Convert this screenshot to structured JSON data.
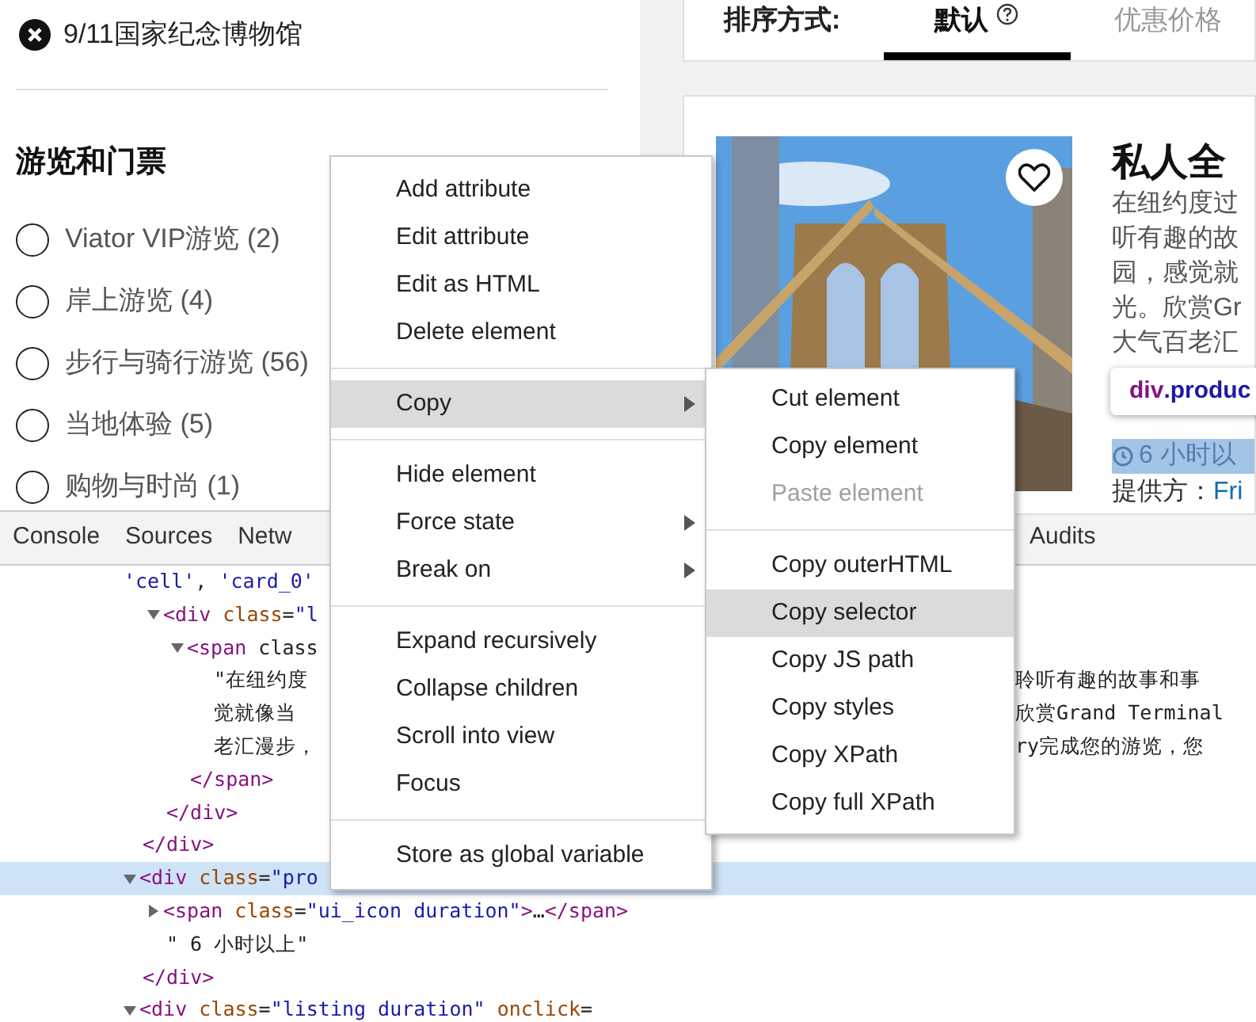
{
  "page": {
    "removed_filter": "9/11国家纪念博物馆",
    "section_title": "游览和门票",
    "filters": [
      {
        "label": "Viator VIP游览 (2)",
        "selected": false
      },
      {
        "label": "岸上游览 (4)",
        "selected": false
      },
      {
        "label": "步行与骑行游览 (56)",
        "selected": false
      },
      {
        "label": "当地体验 (5)",
        "selected": false
      },
      {
        "label": "购物与时尚 (1)",
        "selected": false
      }
    ],
    "sort": {
      "label": "排序方式:",
      "options": [
        {
          "label": "默认",
          "selected": true
        },
        {
          "label": "优惠价格",
          "selected": false
        }
      ]
    },
    "product": {
      "favorited": false,
      "title": "私人全",
      "description_lines": [
        "在纽约度过",
        "听有趣的故",
        "园，感觉就",
        "光。欣赏Gr",
        "大气百老汇"
      ],
      "duration": "6 小时以",
      "supplier_label": "提供方：",
      "supplier_link": "Fri"
    }
  },
  "devtools": {
    "tabs": [
      {
        "label": "Console",
        "selected": false
      },
      {
        "label": "Sources",
        "selected": false
      },
      {
        "label": "Netw",
        "selected": false
      },
      {
        "label": "Audits",
        "selected": false
      }
    ],
    "nodes": [
      {
        "kind": "continuation",
        "text": "'cell', 'card_0'",
        "children": [
          {
            "kind": "element",
            "open": "<div class=\"l",
            "expanded": true,
            "selected": false,
            "children": [
              {
                "kind": "element",
                "open": "<span class",
                "expanded": true,
                "selected": false,
                "children": [
                  {
                    "kind": "text",
                    "text": "\"在纽约度",
                    "overflow": "聆听有趣的故事和事"
                  },
                  {
                    "kind": "text",
                    "text": "觉就像当",
                    "overflow": "欣赏Grand Terminal"
                  },
                  {
                    "kind": "text",
                    "text": "老汇漫步，",
                    "overflow": "ry完成您的游览，您"
                  }
                ],
                "close": "</span>"
              }
            ],
            "close": "</div>"
          }
        ],
        "close": "</div>"
      },
      {
        "kind": "element",
        "open": "<div class=\"pro",
        "expanded": true,
        "selected": true,
        "children": [
          {
            "kind": "element",
            "open": "<span class=\"ui_icon duration\">…</span>",
            "expanded": false,
            "selected": false
          },
          {
            "kind": "text",
            "text": "\" 6 小时以上\""
          }
        ],
        "close": "</div>"
      },
      {
        "kind": "element",
        "open": "<div class=\"listing duration\" onclick=",
        "expanded": true,
        "selected": false
      }
    ]
  },
  "tooltip": {
    "tag": "div",
    "selector": ".produc"
  },
  "context_menu": {
    "groups": [
      [
        {
          "label": "Add attribute",
          "submenu": false,
          "selected": false,
          "disabled": false
        },
        {
          "label": "Edit attribute",
          "submenu": false,
          "selected": false,
          "disabled": false
        },
        {
          "label": "Edit as HTML",
          "submenu": false,
          "selected": false,
          "disabled": false
        },
        {
          "label": "Delete element",
          "submenu": false,
          "selected": false,
          "disabled": false
        }
      ],
      [
        {
          "label": "Copy",
          "submenu": true,
          "selected": true,
          "disabled": false
        }
      ],
      [
        {
          "label": "Hide element",
          "submenu": false,
          "selected": false,
          "disabled": false
        },
        {
          "label": "Force state",
          "submenu": true,
          "selected": false,
          "disabled": false
        },
        {
          "label": "Break on",
          "submenu": true,
          "selected": false,
          "disabled": false
        }
      ],
      [
        {
          "label": "Expand recursively",
          "submenu": false,
          "selected": false,
          "disabled": false
        },
        {
          "label": "Collapse children",
          "submenu": false,
          "selected": false,
          "disabled": false
        },
        {
          "label": "Scroll into view",
          "submenu": false,
          "selected": false,
          "disabled": false
        },
        {
          "label": "Focus",
          "submenu": false,
          "selected": false,
          "disabled": false
        }
      ],
      [
        {
          "label": "Store as global variable",
          "submenu": false,
          "selected": false,
          "disabled": false
        }
      ]
    ]
  },
  "submenu": {
    "groups": [
      [
        {
          "label": "Cut element",
          "selected": false,
          "disabled": false
        },
        {
          "label": "Copy element",
          "selected": false,
          "disabled": false
        },
        {
          "label": "Paste element",
          "selected": false,
          "disabled": true
        }
      ],
      [
        {
          "label": "Copy outerHTML",
          "selected": false,
          "disabled": false
        },
        {
          "label": "Copy selector",
          "selected": true,
          "disabled": false
        },
        {
          "label": "Copy JS path",
          "selected": false,
          "disabled": false
        },
        {
          "label": "Copy styles",
          "selected": false,
          "disabled": false
        },
        {
          "label": "Copy XPath",
          "selected": false,
          "disabled": false
        },
        {
          "label": "Copy full XPath",
          "selected": false,
          "disabled": false
        }
      ]
    ]
  }
}
